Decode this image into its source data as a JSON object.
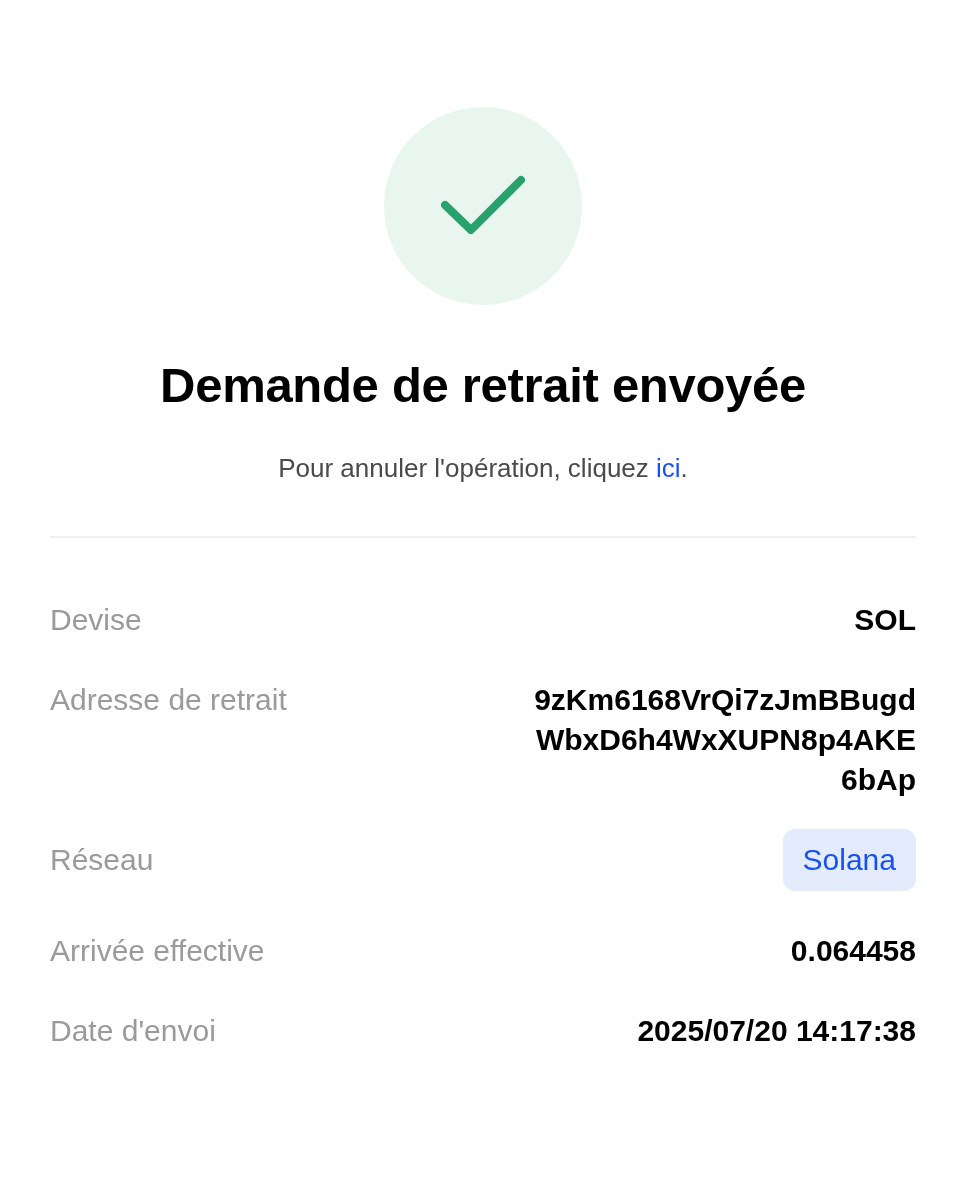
{
  "status": {
    "kind": "success"
  },
  "title": "Demande de retrait envoyée",
  "subtitle": {
    "before": "Pour annuler l'opération, cliquez ",
    "link": "ici",
    "after": "."
  },
  "details": [
    {
      "label": "Devise",
      "kind": "text",
      "lines": [
        "SOL"
      ]
    },
    {
      "label": "Adresse de retrait",
      "kind": "text",
      "lines": [
        "9zKm6168VrQi7zJmBBugd",
        "WbxD6h4WxXUPN8p4AKE",
        "6bAp"
      ]
    },
    {
      "label": "Réseau",
      "kind": "badge",
      "lines": [
        "Solana"
      ]
    },
    {
      "label": "Arrivée effective",
      "kind": "text",
      "lines": [
        "0.064458"
      ]
    },
    {
      "label": "Date d'envoi",
      "kind": "text",
      "lines": [
        "2025/07/20 14:17:38"
      ]
    }
  ]
}
